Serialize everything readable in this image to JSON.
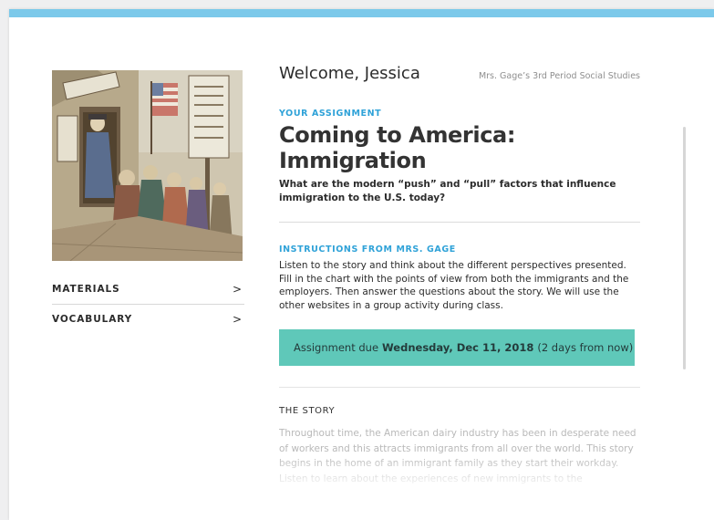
{
  "header": {
    "welcome": "Welcome, Jessica",
    "class_name": "Mrs. Gage’s 3rd Period Social Studies"
  },
  "sidebar": {
    "image_alt": "Historical immigration cartoon illustration",
    "items": [
      {
        "label": "MATERIALS",
        "chevron": ">"
      },
      {
        "label": "VOCABULARY",
        "chevron": ">"
      }
    ]
  },
  "assignment": {
    "kicker": "YOUR ASSIGNMENT",
    "title": "Coming to America: Immigration",
    "question": "What are the modern “push” and “pull” factors that influence immigration to the U.S. today?"
  },
  "instructions": {
    "kicker": "INSTRUCTIONS FROM MRS. GAGE",
    "text": "Listen to the story and think about the different perspectives presented. Fill in the chart with the points of view from both the immigrants and the employers. Then answer the questions about the story. We will use the other websites in a group activity during class."
  },
  "due": {
    "prefix": "Assignment due",
    "date": "Wednesday, Dec 11, 2018",
    "relative": "(2 days from now)"
  },
  "story": {
    "heading": "THE STORY",
    "text": "Throughout time, the American dairy industry has been in desperate need of workers and this attracts immigrants from all over the world. This story begins in the home of an immigrant family as they start their workday. Listen to learn about the experiences of new immigrants to the"
  },
  "colors": {
    "top_bar": "#7cc9ea",
    "accent": "#2fa2d8",
    "due_banner": "#5fc8b9"
  }
}
